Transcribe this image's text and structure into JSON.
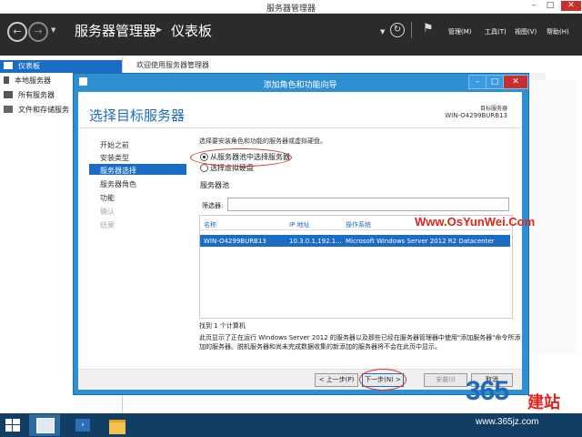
{
  "window": {
    "title": "服务器管理器"
  },
  "header": {
    "breadcrumb_root": "服务器管理器",
    "breadcrumb_sep": "▸",
    "breadcrumb_current": "仪表板",
    "menus": [
      "管理(M)",
      "工具(T)",
      "视图(V)",
      "帮助(H)"
    ]
  },
  "sidebar": {
    "items": [
      {
        "label": "仪表板"
      },
      {
        "label": "本地服务器"
      },
      {
        "label": "所有服务器"
      },
      {
        "label": "文件和存储服务"
      }
    ]
  },
  "main": {
    "welcome": "欢迎使用服务器管理器"
  },
  "dialog": {
    "title": "添加角色和功能向导",
    "heading": "选择目标服务器",
    "dest_label": "目标服务器",
    "dest_server": "WIN-O4299BURB13",
    "steps": [
      "开始之前",
      "安装类型",
      "服务器选择",
      "服务器角色",
      "功能",
      "确认",
      "结果"
    ],
    "description": "选择要安装角色和功能的服务器或虚拟硬盘。",
    "radio_pool": "从服务器池中选择服务器",
    "radio_vhd": "选择虚拟硬盘",
    "pool_title": "服务器池",
    "filter_label": "筛选器:",
    "filter_value": "",
    "columns": [
      "名称",
      "IP 地址",
      "操作系统"
    ],
    "rows": [
      {
        "name": "WIN-O4299BURB13",
        "ip": "10.3.0.1,192.1...",
        "os": "Microsoft Windows Server 2012 R2 Datacenter"
      }
    ],
    "found": "找到 1 个计算机",
    "note": "此页显示了正在运行 Windows Server 2012 的服务器以及那些已经在服务器管理器中使用\"添加服务器\"命令所添加的服务器。脱机服务器和尚未完成数据收集的新添加的服务器将不会在此页中显示。",
    "buttons": {
      "prev": "< 上一步(P)",
      "next": "下一步(N) >",
      "install": "安装(I)",
      "cancel": "取消"
    }
  },
  "watermark": {
    "text": "Www.OsYunWei.Com",
    "color": "#e4211a"
  },
  "branding": {
    "logo_number": "365",
    "logo_text": "建站",
    "url": "www.365jz.com"
  },
  "colors": {
    "accent": "#1a6cc4",
    "dialog_frame": "#2f8fd3",
    "header_bg": "#2b2b2b",
    "taskbar": "#123e63"
  }
}
